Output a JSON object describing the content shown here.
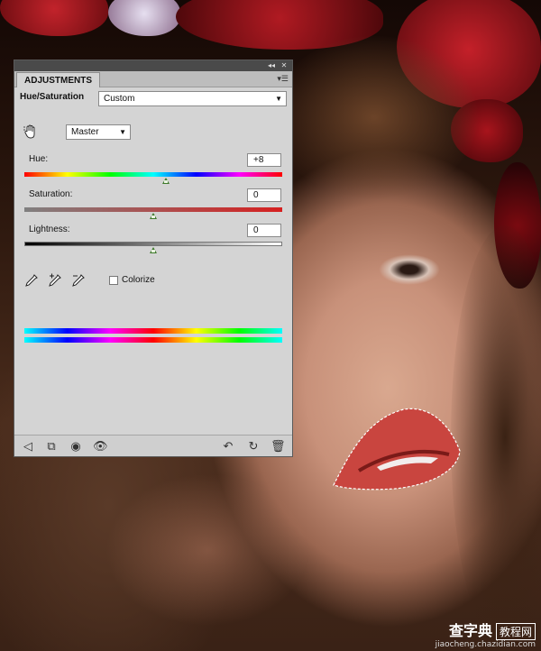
{
  "panel": {
    "tab_label": "ADJUSTMENTS",
    "adjustment_type": "Hue/Saturation",
    "preset_value": "Custom",
    "channel_value": "Master",
    "hue": {
      "label": "Hue:",
      "value": "+8",
      "slider_fraction": 0.55
    },
    "saturation": {
      "label": "Saturation:",
      "value": "0",
      "slider_fraction": 0.5
    },
    "lightness": {
      "label": "Lightness:",
      "value": "0",
      "slider_fraction": 0.5
    },
    "colorize_label": "Colorize",
    "colorize_checked": false
  },
  "icons": {
    "titlebar": [
      "collapse-icon",
      "close-icon"
    ],
    "panel_menu": "panel-menu-icon",
    "targeted_adjust": "hand-adjust-icon",
    "eyedroppers": [
      "eyedropper-icon",
      "eyedropper-add-icon",
      "eyedropper-subtract-icon"
    ],
    "bottom": [
      "back-icon",
      "clip-layer-icon",
      "layer-mask-icon",
      "visibility-eye-icon",
      "view-previous-icon",
      "reset-icon",
      "trash-icon"
    ]
  },
  "watermark": {
    "main": "查字典",
    "boxed": "教程网",
    "url": "jiaocheng.chazidian.com"
  }
}
